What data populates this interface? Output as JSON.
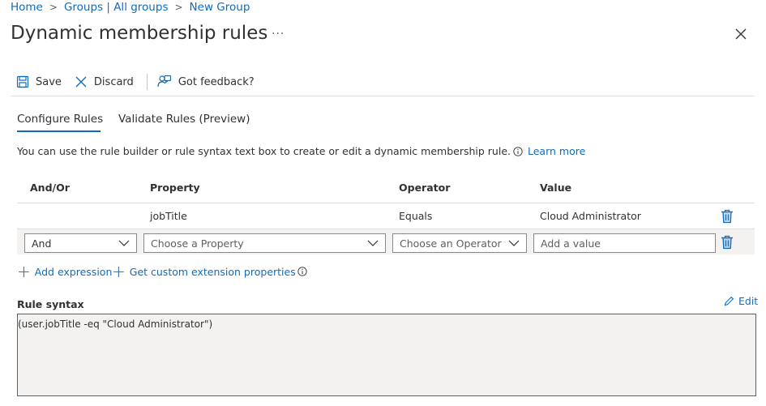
{
  "breadcrumb": {
    "items": [
      "Home",
      "Groups | All groups",
      "New Group"
    ],
    "separator": ">"
  },
  "page": {
    "title": "Dynamic membership rules",
    "more_label": "···"
  },
  "toolbar": {
    "save_label": "Save",
    "discard_label": "Discard",
    "feedback_label": "Got feedback?"
  },
  "tabs": [
    {
      "label": "Configure Rules",
      "active": true
    },
    {
      "label": "Validate Rules (Preview)",
      "active": false
    }
  ],
  "info": {
    "text": "You can use the rule builder or rule syntax text box to create or edit a dynamic membership rule.",
    "learn_more": "Learn more"
  },
  "rules_table": {
    "headers": [
      "And/Or",
      "Property",
      "Operator",
      "Value"
    ],
    "rows": [
      {
        "and_or": "",
        "property": "jobTitle",
        "operator": "Equals",
        "value": "Cloud Administrator"
      }
    ],
    "edit_row": {
      "and_or_selected": "And",
      "property_placeholder": "Choose a Property",
      "operator_placeholder": "Choose an Operator",
      "value_placeholder": "Add a value"
    }
  },
  "actions": {
    "add_expression": "Add expression",
    "custom_extension": "Get custom extension properties"
  },
  "rule_syntax": {
    "label": "Rule syntax",
    "edit_label": "Edit",
    "value": "(user.jobTitle -eq \"Cloud Administrator\")"
  },
  "colors": {
    "accent": "#0f6cbd",
    "trash": "#0f6cbd",
    "row_alt": "#f3f2f1"
  }
}
